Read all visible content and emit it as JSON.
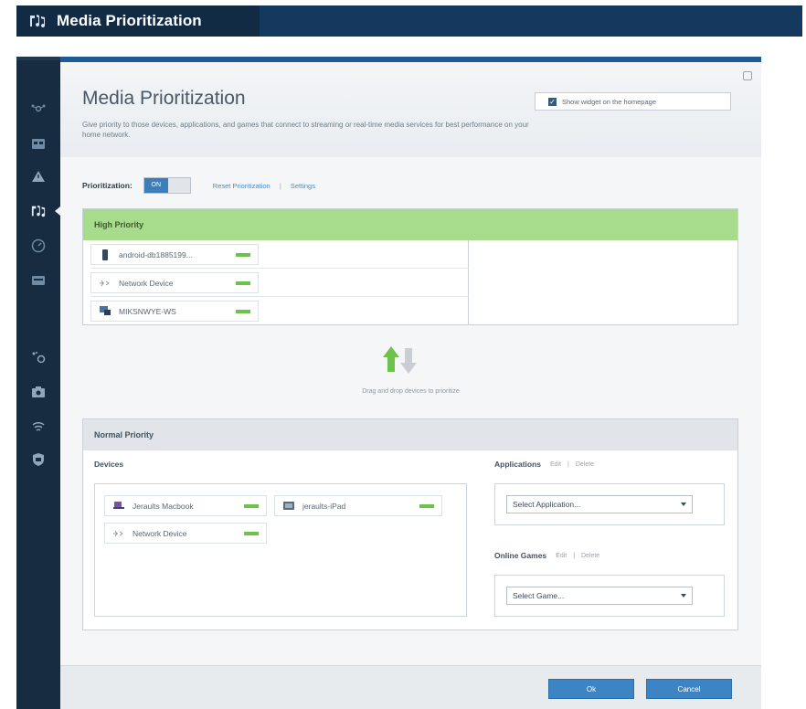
{
  "window": {
    "title": "Media Prioritization"
  },
  "page": {
    "title": "Media Prioritization",
    "description": "Give priority to those devices, applications, and games that connect to streaming or real-time media services for best performance on your home network.",
    "show_widget_label": "Show widget on the homepage",
    "show_widget_checked": true
  },
  "prioritization": {
    "label": "Prioritization:",
    "toggle_on_label": "ON",
    "reset_link": "Reset Prioritization",
    "settings_link": "Settings",
    "separator": "|"
  },
  "high_priority": {
    "title": "High Priority",
    "devices": [
      {
        "name": "android-db1885199...",
        "icon": "phone-icon"
      },
      {
        "name": "Network Device",
        "icon": "network-device-icon"
      },
      {
        "name": "MIKSNWYE-WS",
        "icon": "computer-icon"
      }
    ]
  },
  "drag_hint": "Drag and drop devices to prioritize",
  "normal_priority": {
    "title": "Normal Priority",
    "devices_label": "Devices",
    "devices": [
      {
        "name": "Jeraults Macbook",
        "icon": "laptop-icon"
      },
      {
        "name": "jeraults-iPad",
        "icon": "tablet-icon"
      },
      {
        "name": "Network Device",
        "icon": "network-device-icon"
      }
    ],
    "applications": {
      "label": "Applications",
      "edit": "Edit",
      "delete": "Delete",
      "separator": "|",
      "select_value": "Select Application..."
    },
    "games": {
      "label": "Online Games",
      "edit": "Edit",
      "delete": "Delete",
      "separator": "|",
      "select_value": "Select Game..."
    }
  },
  "footer": {
    "ok_label": "Ok",
    "cancel_label": "Cancel"
  },
  "colors": {
    "accent": "#3d84c4",
    "high_priority_header": "#a6dc8c",
    "status_green": "#6cc24a",
    "sidebar": "#172c40"
  }
}
